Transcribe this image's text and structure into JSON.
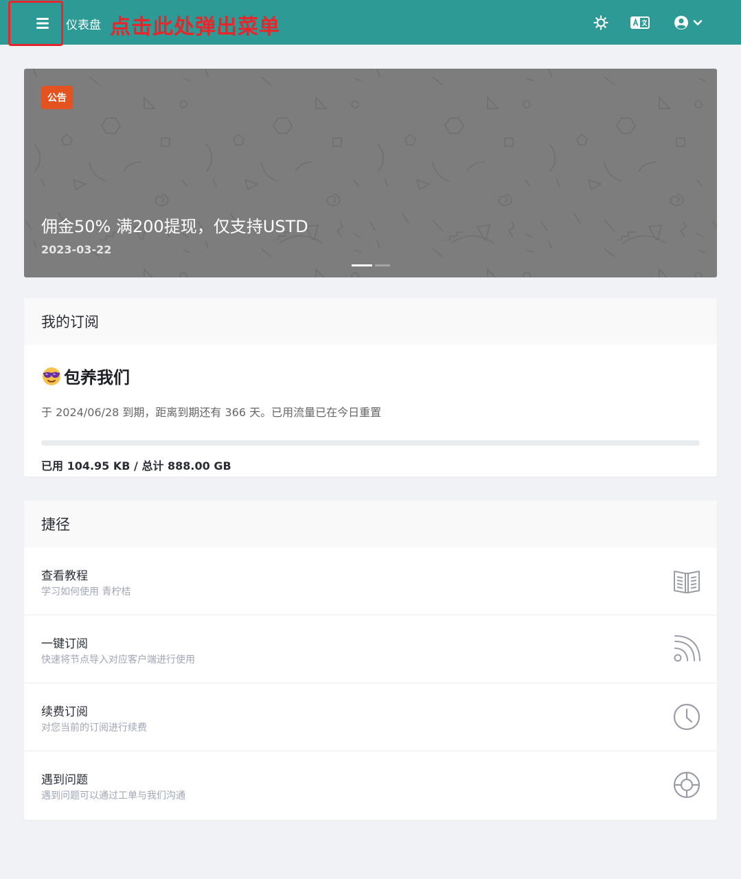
{
  "header": {
    "title": "仪表盘",
    "annotation": "点击此处弹出菜单",
    "icons": [
      "menu-icon",
      "sun-icon",
      "translate-icon",
      "user-icon",
      "chevron-down-icon"
    ],
    "bg_color": "#2e9a96",
    "annotation_color": "#e6262a"
  },
  "banner": {
    "badge": "公告",
    "title": "佣金50% 满200提现，仅支持USTD",
    "date": "2023-03-22",
    "badge_color": "#e4521f"
  },
  "subscription": {
    "heading": "我的订阅",
    "plan_name": "包养我们",
    "plan_emoji": "😎",
    "description": "于 2024/06/28 到期，距离到期还有 366 天。已用流量已在今日重置",
    "usage": "已用 104.95 KB / 总计 888.00 GB",
    "usage_fraction": 0.0
  },
  "shortcuts": {
    "heading": "捷径",
    "items": [
      {
        "title": "查看教程",
        "subtitle": "学习如何使用 青柠桔",
        "icon": "book-icon"
      },
      {
        "title": "一键订阅",
        "subtitle": "快速将节点导入对应客户端进行使用",
        "icon": "rss-icon"
      },
      {
        "title": "续费订阅",
        "subtitle": "对您当前的订阅进行续费",
        "icon": "clock-icon"
      },
      {
        "title": "遇到问题",
        "subtitle": "遇到问题可以通过工单与我们沟通",
        "icon": "lifebuoy-icon"
      }
    ]
  }
}
